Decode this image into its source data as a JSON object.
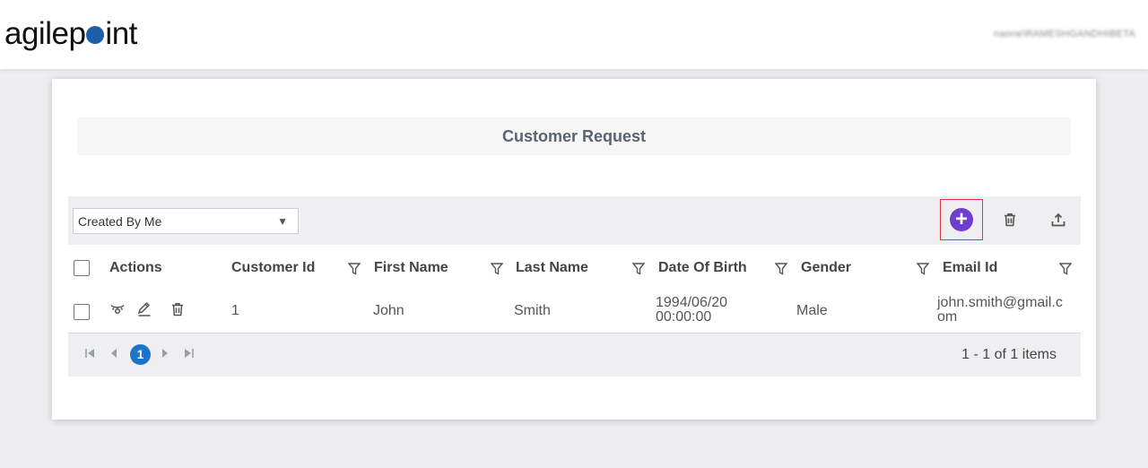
{
  "app": {
    "logo_prefix": "agilep",
    "logo_suffix": "int",
    "username": "naone\\RAMESHGANDHIBETA"
  },
  "form": {
    "title": "Customer Request"
  },
  "grid": {
    "view_select": "Created By Me",
    "toolbar": {
      "add_icon": "plus-circle-icon",
      "delete_icon": "trash-icon",
      "upload_icon": "upload-icon",
      "accent": "#6e3dd1",
      "highlight": "#e3343b"
    },
    "columns": [
      {
        "label": "Actions"
      },
      {
        "label": "Customer Id"
      },
      {
        "label": "First Name"
      },
      {
        "label": "Last Name"
      },
      {
        "label": "Date Of Birth"
      },
      {
        "label": "Gender"
      },
      {
        "label": "Email Id"
      }
    ],
    "rows": [
      {
        "customer_id": "1",
        "first_name": "John",
        "last_name": "Smith",
        "dob_line1": "1994/06/20",
        "dob_line2": "00:00:00",
        "gender": "Male",
        "email_line1": "john.smith@gmail.c",
        "email_line2": "om"
      }
    ],
    "pager": {
      "current_page": "1",
      "info": "1 - 1 of 1 items",
      "page_color": "#1a75c9"
    }
  }
}
